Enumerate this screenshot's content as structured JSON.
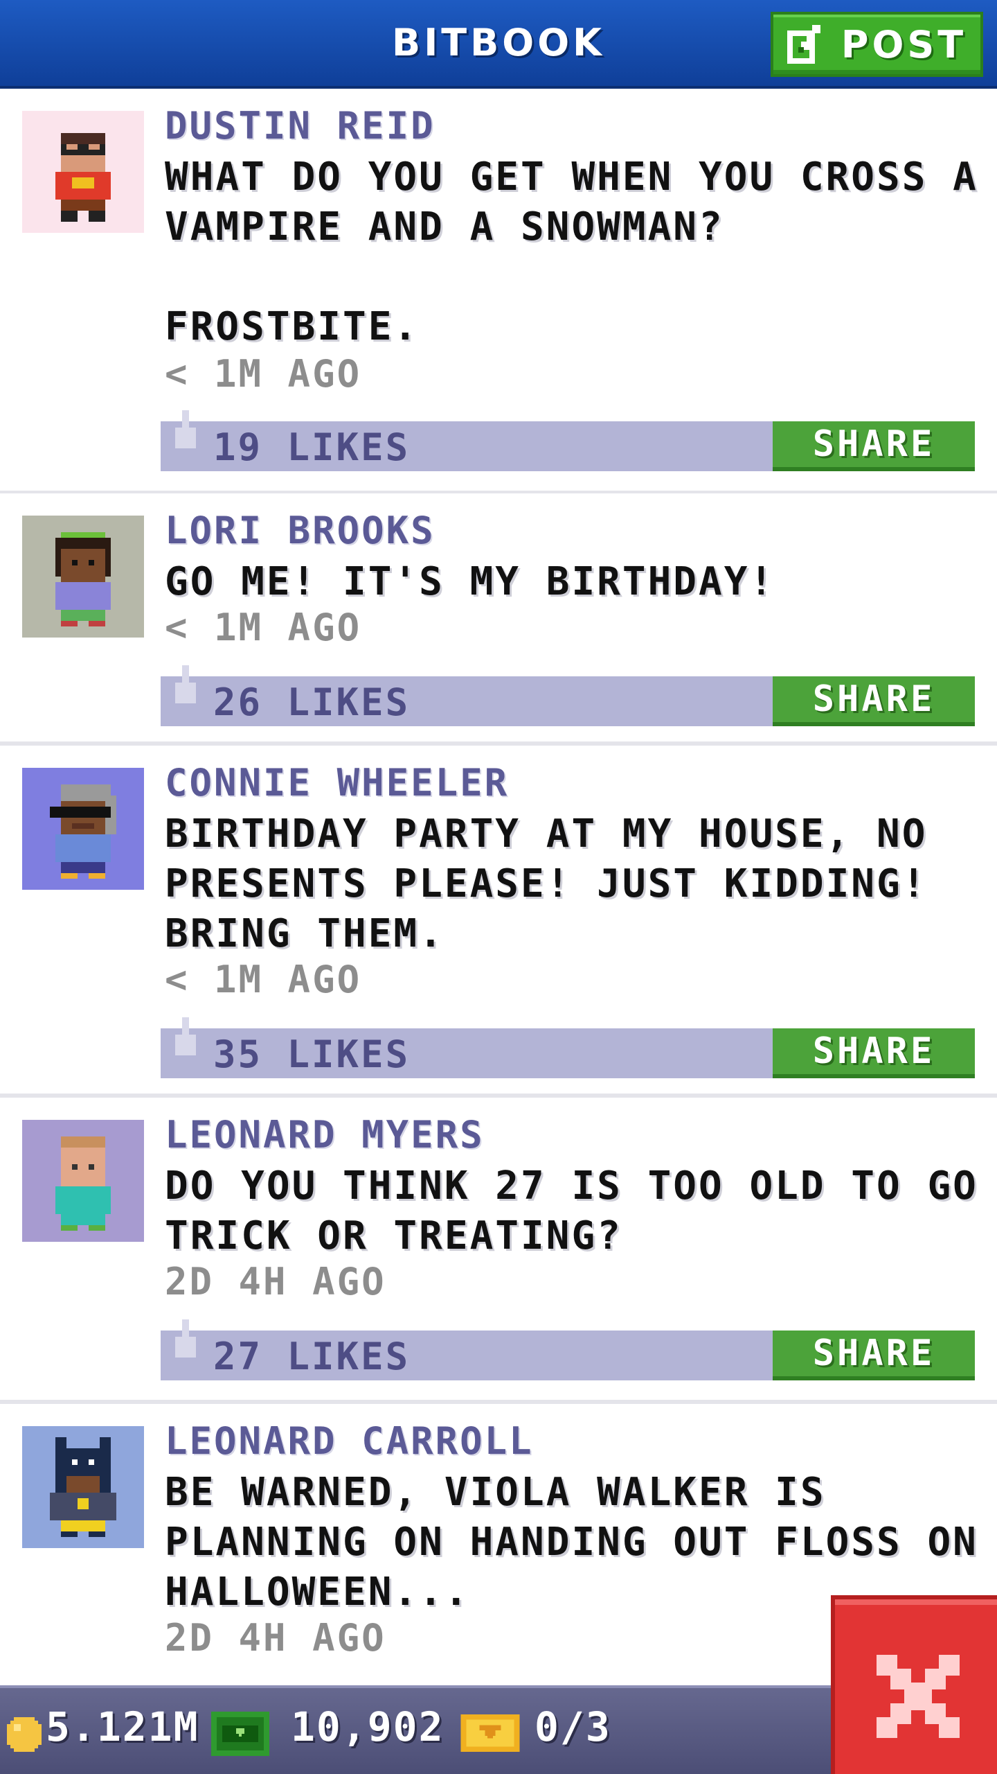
{
  "header": {
    "title": "BITBOOK",
    "post_label": "POST"
  },
  "posts": [
    {
      "author": "DUSTIN REID",
      "text": "WHAT DO YOU GET WHEN YOU CROSS A\nVAMPIRE AND A SNOWMAN?\n\nFROSTBITE.",
      "time": "< 1M AGO",
      "likes": "19 LIKES",
      "share": "SHARE",
      "avatar_bg": "#fbe4ec"
    },
    {
      "author": "LORI BROOKS",
      "text": "GO ME! IT'S MY BIRTHDAY!",
      "time": "< 1M AGO",
      "likes": "26 LIKES",
      "share": "SHARE",
      "avatar_bg": "#b6b8a9"
    },
    {
      "author": "CONNIE WHEELER",
      "text": "BIRTHDAY PARTY AT MY HOUSE, NO\nPRESENTS PLEASE! JUST KIDDING!\nBRING THEM.",
      "time": "< 1M AGO",
      "likes": "35 LIKES",
      "share": "SHARE",
      "avatar_bg": "#7f7ee0"
    },
    {
      "author": "LEONARD MYERS",
      "text": "DO YOU THINK 27 IS TOO OLD TO GO\nTRICK OR TREATING?",
      "time": "2D 4H AGO",
      "likes": "27 LIKES",
      "share": "SHARE",
      "avatar_bg": "#a79bd0"
    },
    {
      "author": "LEONARD CARROLL",
      "text": "BE WARNED, VIOLA WALKER IS\nPLANNING ON HANDING OUT FLOSS ON\nHALLOWEEN...",
      "time": "2D 4H AGO",
      "avatar_bg": "#8fa6dc"
    }
  ],
  "footer": {
    "coins": "5.121M",
    "bux": "10,902",
    "tickets": "0/3"
  },
  "colors": {
    "header_blue": "#1a52b5",
    "accent_green": "#3fae2a",
    "author_purple": "#5b5a96",
    "likes_bar": "#b3b4d6",
    "close_red": "#e23434"
  },
  "icons": [
    "edit-icon",
    "thumbs-up-icon",
    "coin-icon",
    "bux-icon",
    "ticket-icon",
    "close-icon"
  ]
}
